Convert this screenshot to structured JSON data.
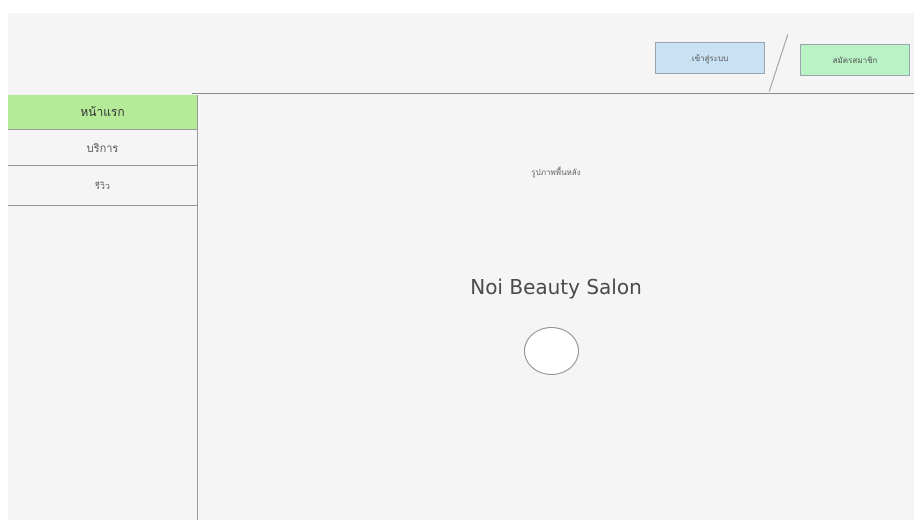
{
  "header": {
    "login_label": "เข้าสู่ระบบ",
    "register_label": "สมัครสมาชิก"
  },
  "sidebar": {
    "items": [
      {
        "label": "หน้าแรก",
        "active": true
      },
      {
        "label": "บริการ",
        "active": false
      },
      {
        "label": "รีวิว",
        "active": false
      }
    ]
  },
  "main": {
    "background_caption": "รูปภาพพื้นหลัง",
    "title": "Noi Beauty Salon"
  },
  "colors": {
    "active_nav": "#b5ea98",
    "login_button": "#c9e2f3",
    "register_button": "#b9f2c4"
  }
}
